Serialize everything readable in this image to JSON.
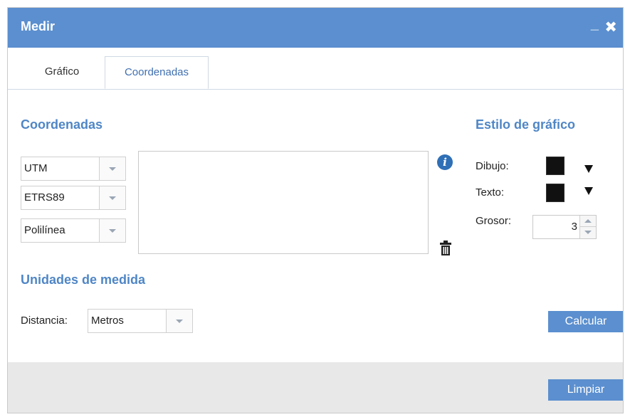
{
  "window": {
    "title": "Medir"
  },
  "tabs": [
    {
      "label": "Gráfico"
    },
    {
      "label": "Coordenadas"
    }
  ],
  "coordinates": {
    "section_title": "Coordenadas",
    "system_select": "UTM",
    "datum_select": "ETRS89",
    "geometry_select": "Polilínea",
    "textarea_value": ""
  },
  "graphic_style": {
    "section_title": "Estilo de gráfico",
    "drawing_label": "Dibujo:",
    "text_label": "Texto:",
    "thickness_label": "Grosor:",
    "thickness_value": "3",
    "drawing_color": "#111111",
    "text_color": "#111111"
  },
  "units": {
    "section_title": "Unidades de medida",
    "distance_label": "Distancia:",
    "distance_select": "Metros"
  },
  "buttons": {
    "calculate": "Calcular",
    "clear": "Limpiar"
  },
  "icons": {
    "info": "info-icon",
    "delete": "trash-icon",
    "minimize": "minimize-icon",
    "close": "close-icon"
  },
  "colors": {
    "accent": "#5b8fcf",
    "section_title": "#4f86c6",
    "footer_bg": "#e8e8e8"
  }
}
